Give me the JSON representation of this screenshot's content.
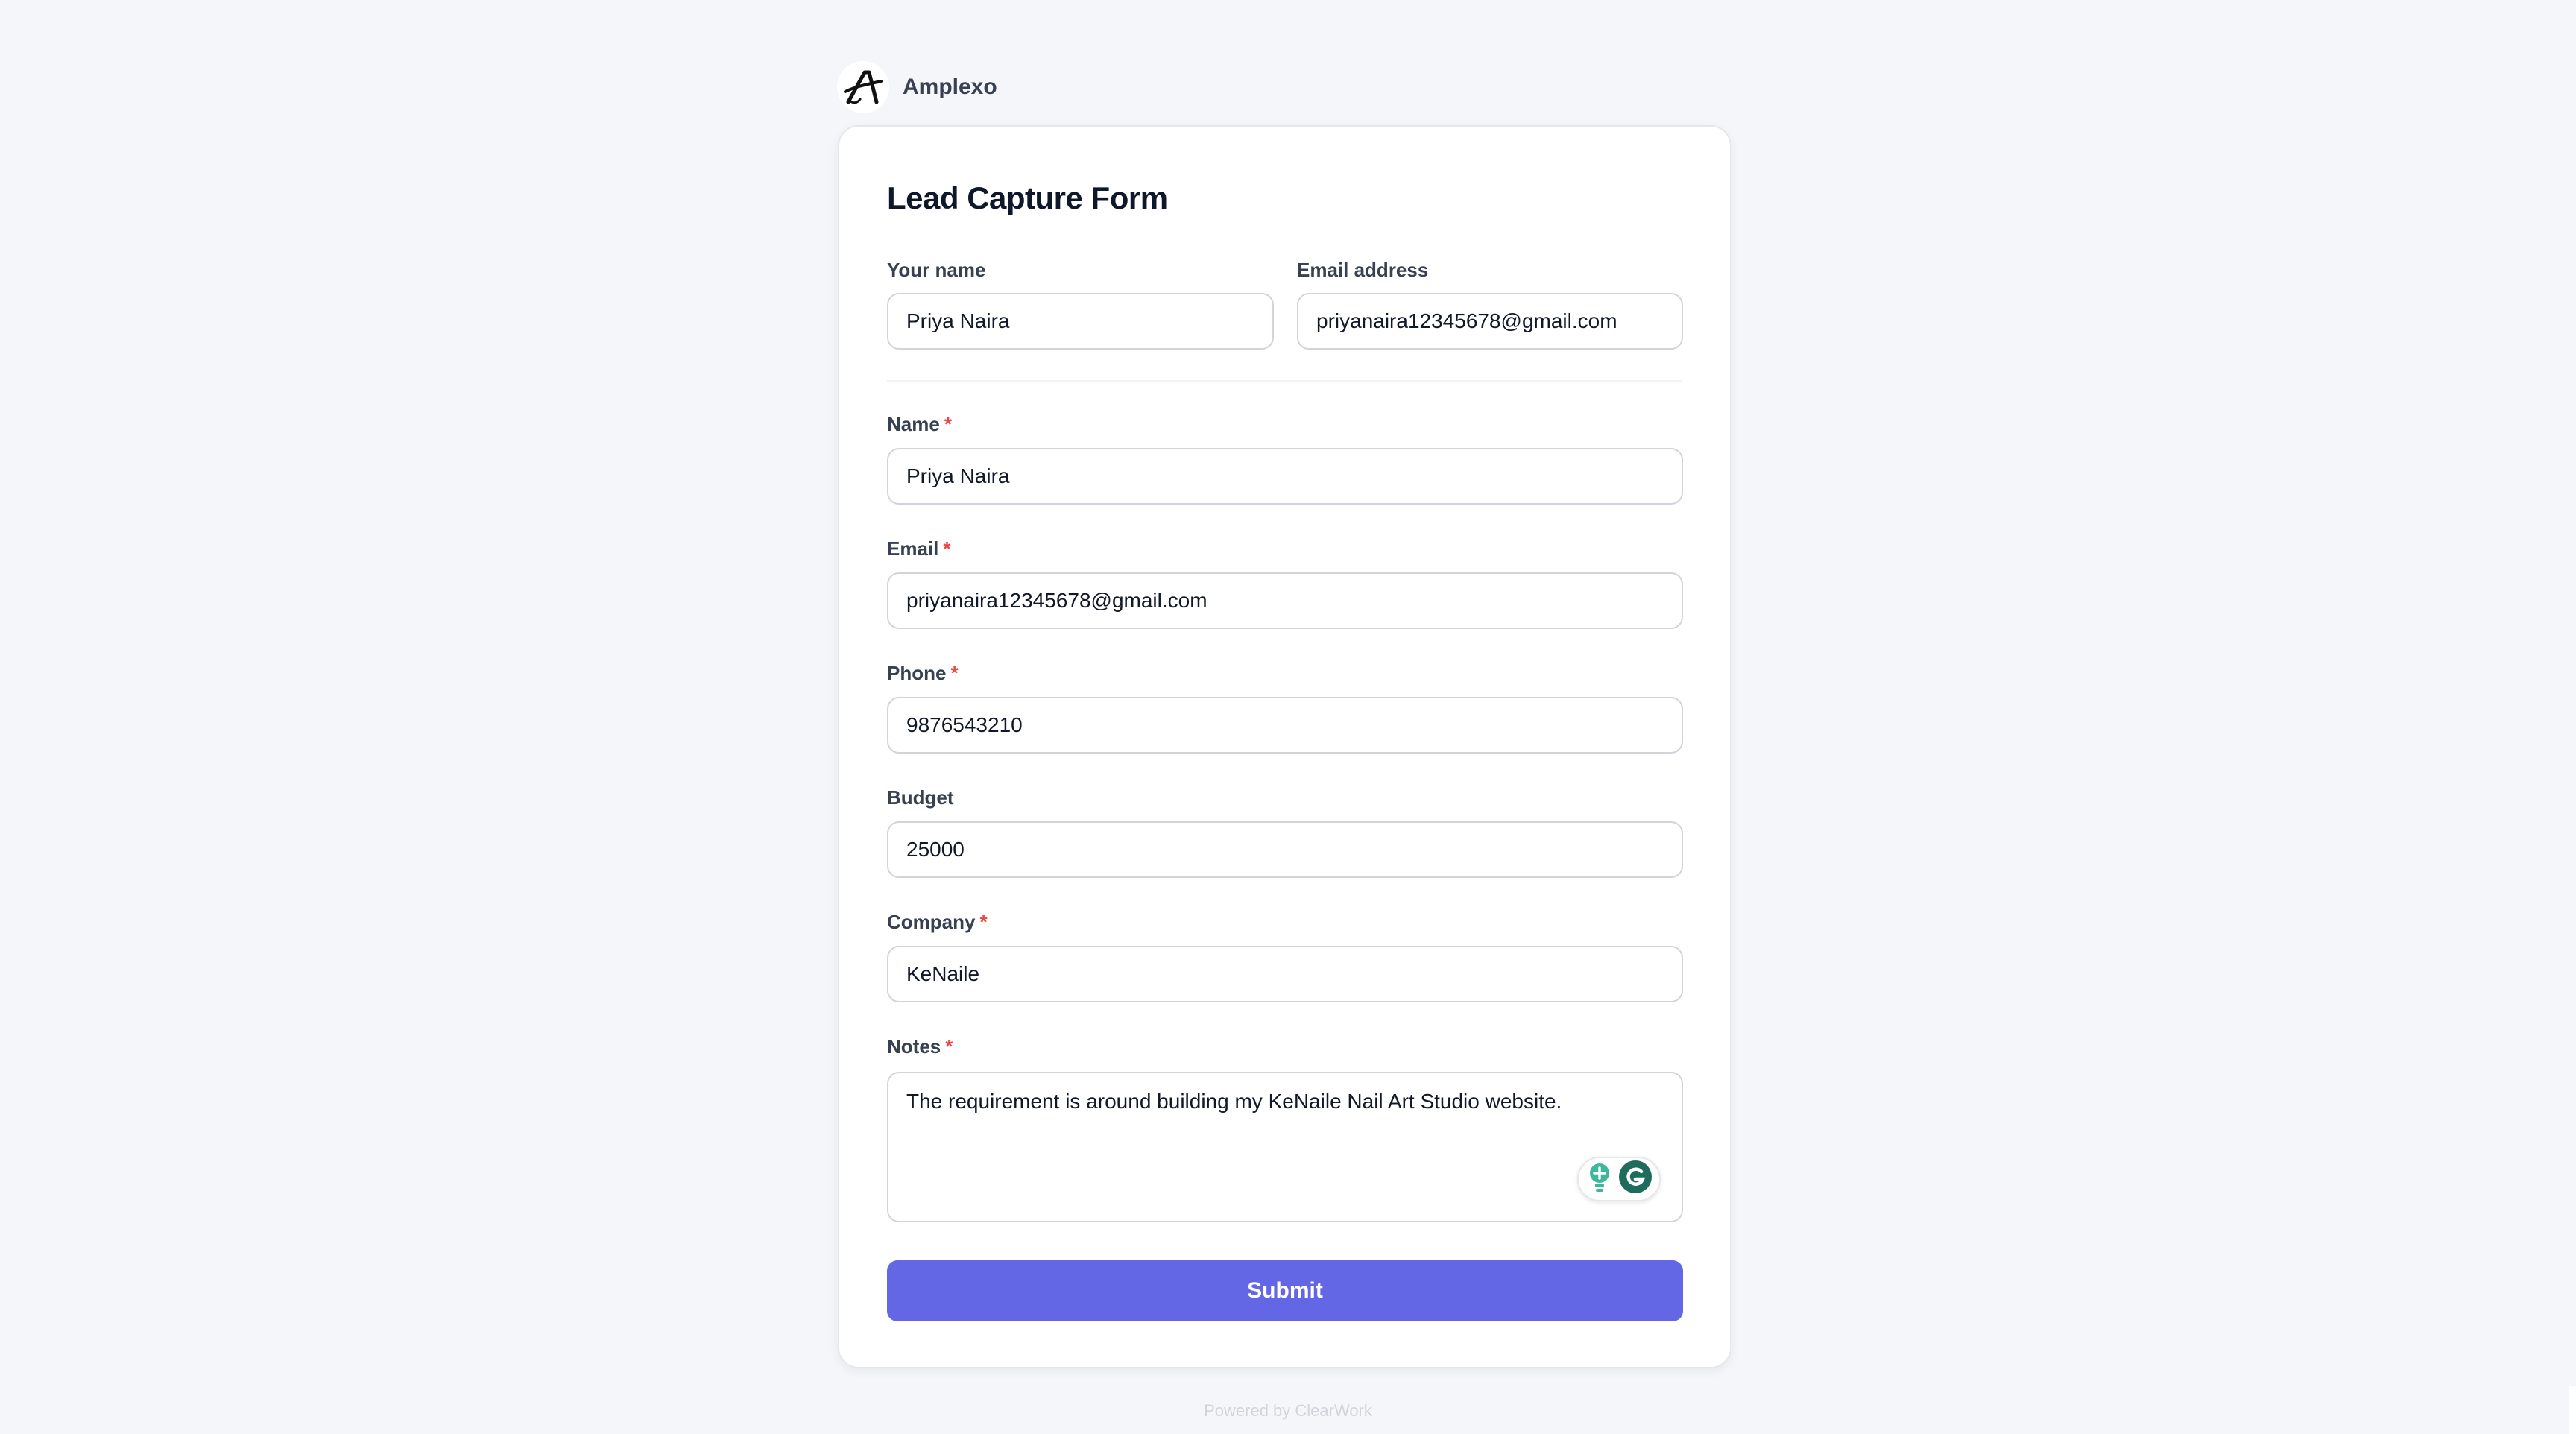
{
  "brand": {
    "name": "Amplexo",
    "logo_icon": "amplexo-logo-icon"
  },
  "form": {
    "title": "Lead Capture Form",
    "contact": {
      "your_name_label": "Your name",
      "your_name_value": "Priya Naira",
      "email_address_label": "Email address",
      "email_address_value": "priyanaira12345678@gmail.com"
    },
    "fields": {
      "name": {
        "label": "Name",
        "required": "*",
        "value": "Priya Naira"
      },
      "email": {
        "label": "Email",
        "required": "*",
        "value": "priyanaira12345678@gmail.com"
      },
      "phone": {
        "label": "Phone",
        "required": "*",
        "value": "9876543210"
      },
      "budget": {
        "label": "Budget",
        "value": "25000"
      },
      "company": {
        "label": "Company",
        "required": "*",
        "value": "KeNaile"
      },
      "notes": {
        "label": "Notes",
        "required": "*",
        "value": "The requirement is around building my KeNaile Nail Art Studio website."
      }
    },
    "submit_label": "Submit"
  },
  "footer": {
    "powered_by": "Powered by ClearWork"
  },
  "colors": {
    "accent": "#6366e5",
    "required": "#ef4444",
    "background": "#f4f6fa",
    "border": "#d1d5db"
  },
  "icons": {
    "extension_bulb": "lightbulb-plus-icon",
    "extension_grammarly": "grammarly-icon"
  }
}
